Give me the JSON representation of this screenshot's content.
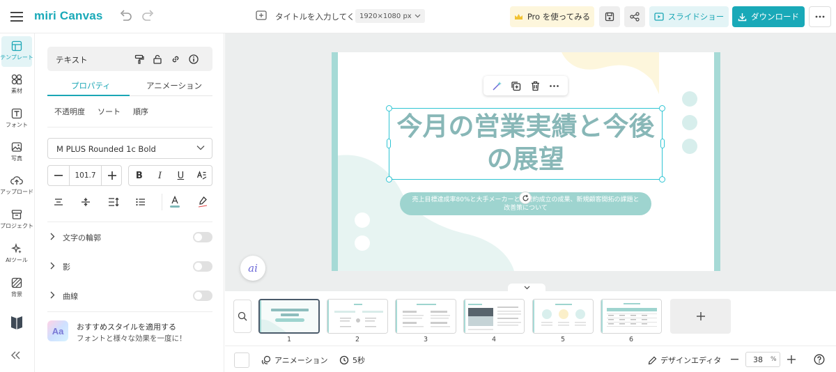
{
  "header": {
    "logo": "miri Canvas",
    "doc_title": "タイトルを入力してく...",
    "size_label": "1920×1080 px",
    "pro_label": "Pro を使ってみる",
    "slideshow_label": "スライドショー",
    "download_label": "ダウンロード"
  },
  "rail": {
    "items": [
      {
        "label": "テンプレート",
        "icon": "template-icon",
        "active": true
      },
      {
        "label": "素材",
        "icon": "elements-icon"
      },
      {
        "label": "フォント",
        "icon": "font-icon"
      },
      {
        "label": "写真",
        "icon": "photo-icon"
      },
      {
        "label": "アップロード",
        "icon": "upload-icon"
      },
      {
        "label": "プロジェクト",
        "icon": "project-icon"
      },
      {
        "label": "AIツール",
        "icon": "ai-tools-icon"
      },
      {
        "label": "背景",
        "icon": "background-icon"
      }
    ]
  },
  "panel": {
    "header_title": "テキスト",
    "tabs": [
      "プロパティ",
      "アニメーション"
    ],
    "subtabs": [
      "不透明度",
      "ソート",
      "順序"
    ],
    "font_name": "M PLUS Rounded 1c Bold",
    "font_size": "101.7",
    "format": {
      "bold": "B",
      "italic": "I",
      "underline": "U"
    },
    "toggles": [
      {
        "label": "文字の輪郭",
        "on": false
      },
      {
        "label": "影",
        "on": false
      },
      {
        "label": "曲線",
        "on": false
      }
    ],
    "promo_title": "おすすめスタイルを適用する",
    "promo_sub": "フォントと様々な効果を一度に！",
    "promo_icon": "Aa"
  },
  "slide": {
    "title_line1": "今月の営業実績と今後",
    "title_line2": "の展望",
    "subtitle_line1": "売上目標達成率80%と大手メーカーとの契約成立の成果、新規顧客開拓の課題と",
    "subtitle_line2": "改善策について"
  },
  "ai_label": "ai",
  "thumbnails": [
    {
      "num": "1",
      "active": true
    },
    {
      "num": "2"
    },
    {
      "num": "3"
    },
    {
      "num": "4"
    },
    {
      "num": "5"
    },
    {
      "num": "6"
    }
  ],
  "bottombar": {
    "animation_label": "アニメーション",
    "duration_label": "5秒",
    "design_editor_label": "デザインエディタ",
    "zoom_value": "38",
    "zoom_unit": "%"
  },
  "colors": {
    "accent": "#19a9b8",
    "slide_title": "#88b7b7",
    "slide_pill": "#9ed4cf",
    "slide_side_bar": "#a6dad6",
    "slide_yellow_blob": "#fdf6dc"
  }
}
